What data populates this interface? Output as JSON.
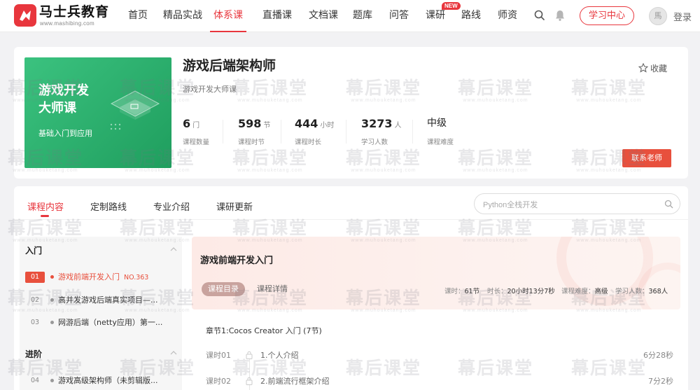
{
  "header": {
    "logo_text": "马士兵教育",
    "logo_url": "www.mashibing.com",
    "nav": [
      {
        "label": "首页"
      },
      {
        "label": "精品实战"
      },
      {
        "label": "体系课"
      },
      {
        "label": "直播课"
      },
      {
        "label": "文档课"
      },
      {
        "label": "题库"
      },
      {
        "label": "问答"
      },
      {
        "label": "课研",
        "badge": "NEW"
      },
      {
        "label": "路线"
      },
      {
        "label": "师资"
      }
    ],
    "study_center": "学习中心",
    "avatar_text": "馬",
    "login": "登录"
  },
  "course": {
    "cover_line1": "游戏开发",
    "cover_line2": "大师课",
    "cover_line3": "基础入门到应用",
    "title": "游戏后端架构师",
    "subtitle": "游戏开发大师课",
    "favorite": "收藏",
    "stats": [
      {
        "value": "6",
        "unit": "门",
        "label": "课程数量"
      },
      {
        "value": "598",
        "unit": "节",
        "label": "课程时节"
      },
      {
        "value": "444",
        "unit": "小时",
        "label": "课程时长"
      },
      {
        "value": "3273",
        "unit": "人",
        "label": "学习人数"
      },
      {
        "value": "中级",
        "unit": "",
        "label": "课程难度"
      }
    ],
    "contact": "联系老师"
  },
  "tabs": [
    "课程内容",
    "定制路线",
    "专业介绍",
    "课研更新"
  ],
  "search": {
    "placeholder": "Python全栈开发"
  },
  "sidebar": {
    "sections": [
      {
        "title": "入门",
        "items": [
          {
            "no": "01",
            "text": "游戏前端开发入门",
            "tag": "NO.363"
          },
          {
            "no": "02",
            "text": "高并发游戏后端真实项目—..."
          },
          {
            "no": "03",
            "text": "网游后端（netty应用）第一..."
          }
        ]
      },
      {
        "title": "进阶",
        "items": [
          {
            "no": "04",
            "text": "游戏高级架构师（未剪辑版..."
          }
        ]
      }
    ]
  },
  "detail": {
    "title": "游戏前端开发入门",
    "tab_on": "课程目录",
    "tab_off": "课程详情",
    "meta": [
      {
        "k": "课时：",
        "v": "61节"
      },
      {
        "k": "时长：",
        "v": "20小时13分7秒"
      },
      {
        "k": "课程难度：",
        "v": "高级"
      },
      {
        "k": "学习人数：",
        "v": "368人"
      }
    ],
    "chapter": "章节1:Cocos Creator 入门 (7节)",
    "lessons": [
      {
        "no": "课时01",
        "name": "1.个人介绍",
        "time": "6分28秒"
      },
      {
        "no": "课时02",
        "name": "2.前端流行框架介绍",
        "time": "7分2秒"
      }
    ]
  },
  "watermark": {
    "cn": "幕后课堂",
    "en": "www.muhouketang.com"
  }
}
